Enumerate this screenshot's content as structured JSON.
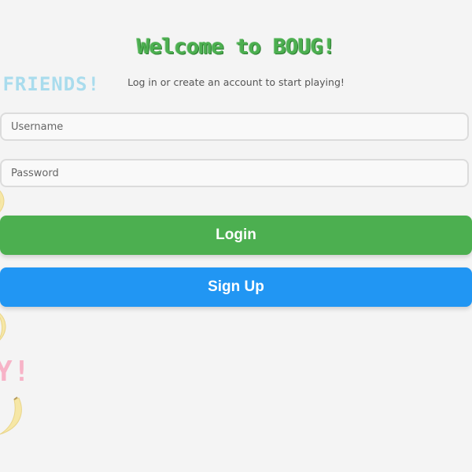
{
  "colors": {
    "background": "#f4f4f4",
    "accent_green": "#4caf50",
    "accent_blue": "#2196f3"
  },
  "decorations": {
    "friends_text": "FRIENDS!",
    "y_text": "Y!",
    "banana_icon": "banana-icon"
  },
  "header": {
    "title": "Welcome to BOUG!",
    "subtitle": "Log in or create an account to start playing!"
  },
  "form": {
    "username_placeholder": "Username",
    "username_value": "",
    "password_placeholder": "Password",
    "password_value": ""
  },
  "actions": {
    "login_label": "Login",
    "signup_label": "Sign Up"
  }
}
